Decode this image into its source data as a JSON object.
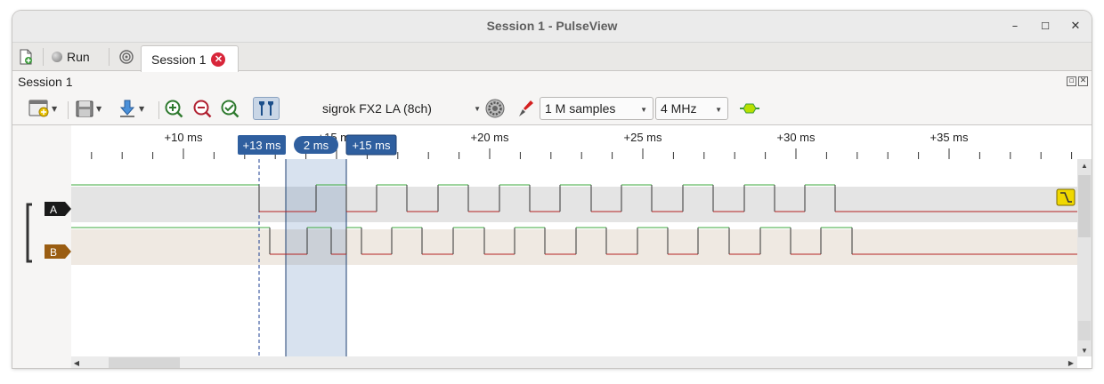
{
  "window": {
    "title": "Session 1 - PulseView"
  },
  "tabbar": {
    "run_label": "Run",
    "tab_label": "Session 1"
  },
  "dock": {
    "title": "Session 1"
  },
  "toolbar": {
    "device": "sigrok FX2 LA (8ch)",
    "samples": "1 M samples",
    "samplerate": "4 MHz"
  },
  "ruler": {
    "ticks": [
      "+10 ms",
      "+15 ms",
      "+20 ms",
      "+25 ms",
      "+30 ms",
      "+35 ms"
    ],
    "cursor_left": "+13 ms",
    "cursor_width": "2 ms",
    "cursor_right": "+15 ms"
  },
  "channels": [
    {
      "name": "A",
      "color": "#1a1a1a",
      "trigger": "falling-edge"
    },
    {
      "name": "B",
      "color": "#9a5d12"
    }
  ],
  "colors": {
    "high": "#3daa3d",
    "low": "#b52222",
    "selection": "#3c6fb0",
    "accent": "#f0d800"
  }
}
